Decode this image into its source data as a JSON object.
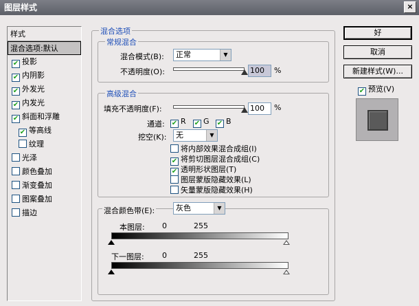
{
  "window": {
    "title": "图层样式",
    "close_label": "×"
  },
  "style_list": {
    "header": "样式",
    "items": [
      {
        "label": "混合选项:默认",
        "checkbox": false,
        "checked": false
      },
      {
        "label": "投影",
        "checkbox": true,
        "checked": true
      },
      {
        "label": "内阴影",
        "checkbox": true,
        "checked": true
      },
      {
        "label": "外发光",
        "checkbox": true,
        "checked": true
      },
      {
        "label": "内发光",
        "checkbox": true,
        "checked": true
      },
      {
        "label": "斜面和浮雕",
        "checkbox": true,
        "checked": true
      },
      {
        "label": "等高线",
        "checkbox": true,
        "checked": true
      },
      {
        "label": "纹理",
        "checkbox": true,
        "checked": false
      },
      {
        "label": "光泽",
        "checkbox": true,
        "checked": false
      },
      {
        "label": "颜色叠加",
        "checkbox": true,
        "checked": false
      },
      {
        "label": "渐变叠加",
        "checkbox": true,
        "checked": false
      },
      {
        "label": "图案叠加",
        "checkbox": true,
        "checked": false
      },
      {
        "label": "描边",
        "checkbox": true,
        "checked": false
      }
    ]
  },
  "blend_options": {
    "title": "混合选项",
    "general": {
      "title": "常规混合",
      "mode_label": "混合模式(B):",
      "mode_value": "正常",
      "opacity_label": "不透明度(O):",
      "opacity_value": "100",
      "opacity_unit": "%",
      "opacity_level": 1.0
    },
    "advanced": {
      "title": "高级混合",
      "fill_label": "填充不透明度(F):",
      "fill_value": "100",
      "fill_unit": "%",
      "fill_level": 1.0,
      "channels_label": "通道:",
      "channels": [
        "R",
        "G",
        "B"
      ],
      "knockout_label": "挖空(K):",
      "knockout_value": "无",
      "options": [
        {
          "label": "将内部效果混合成组(I)",
          "checked": false
        },
        {
          "label": "将剪切图层混合成组(C)",
          "checked": true
        },
        {
          "label": "透明形状图层(T)",
          "checked": true
        },
        {
          "label": "图层蒙版隐藏效果(L)",
          "checked": false
        },
        {
          "label": "矢量蒙版隐藏效果(H)",
          "checked": false
        }
      ]
    },
    "blend_if": {
      "label": "混合颜色带(E):",
      "value": "灰色",
      "this_layer_label": "本图层:",
      "this_layer_min": "0",
      "this_layer_max": "255",
      "underlying_label": "下一图层:",
      "underlying_min": "0",
      "underlying_max": "255"
    }
  },
  "buttons": {
    "ok": "好",
    "cancel": "取消",
    "new_style": "新建样式(W)...",
    "preview_label": "预览(V)",
    "preview_checked": true
  },
  "check_glyph": "✔",
  "dropdown_glyph": "▼"
}
